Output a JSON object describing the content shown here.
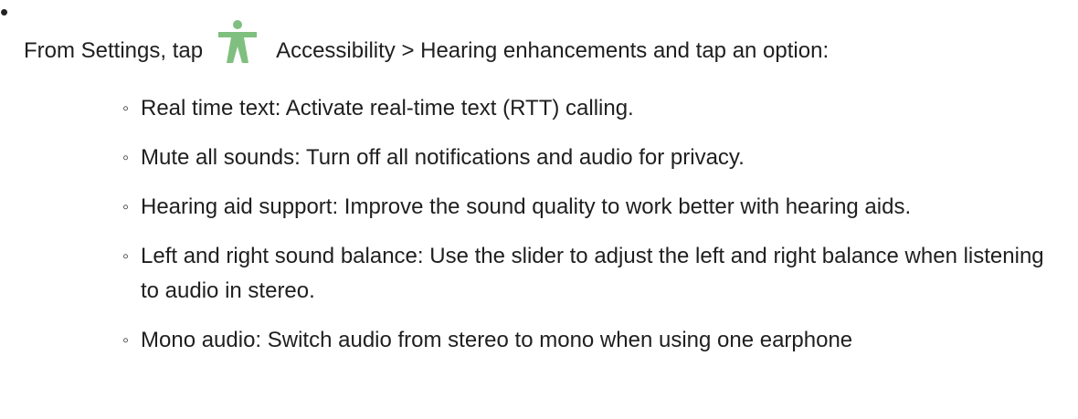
{
  "bullet": "•",
  "intro": {
    "before_icon": "From Settings, tap",
    "icon": "accessibility-icon",
    "icon_color": "#7fbf7f",
    "after_icon": "Accessibility > Hearing enhancements and tap an option:"
  },
  "options": [
    {
      "marker": "◦",
      "text": "Real time text: Activate real-time text (RTT) calling."
    },
    {
      "marker": "◦",
      "text": "Mute all sounds: Turn off all notifications and audio for privacy."
    },
    {
      "marker": "◦",
      "text": "Hearing aid support: Improve the sound quality to work better with hearing aids."
    },
    {
      "marker": "◦",
      "text": "Left and right sound balance: Use the slider to adjust the left and right balance when listening to audio in stereo."
    },
    {
      "marker": "◦",
      "text": "Mono audio: Switch audio from stereo to mono when using one earphone"
    }
  ]
}
